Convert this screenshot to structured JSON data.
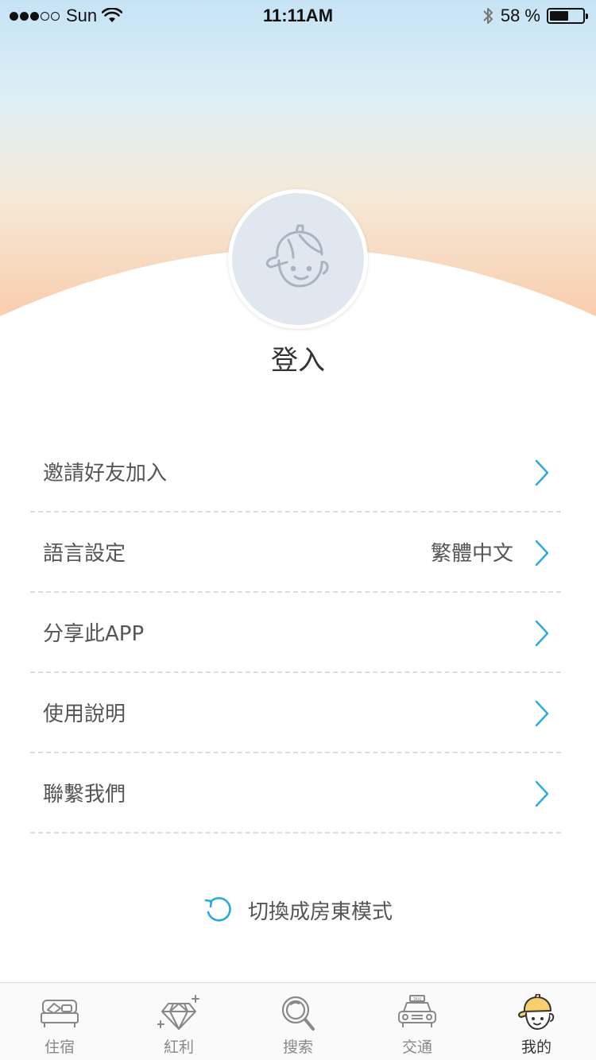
{
  "status_bar": {
    "carrier": "Sun",
    "time": "11:11AM",
    "battery_text": "58 %",
    "battery_level": 0.58
  },
  "profile": {
    "login_label": "登入",
    "avatar_icon": "boy-with-cap-icon"
  },
  "menu": {
    "items": [
      {
        "label": "邀請好友加入",
        "value": ""
      },
      {
        "label": "語言設定",
        "value": "繁體中文"
      },
      {
        "label": "分享此APP",
        "value": ""
      },
      {
        "label": "使用說明",
        "value": ""
      },
      {
        "label": "聯繫我們",
        "value": ""
      }
    ]
  },
  "switch_mode": {
    "label": "切換成房東模式",
    "icon": "refresh-icon"
  },
  "tab_bar": {
    "tabs": [
      {
        "label": "住宿",
        "icon": "bed-icon",
        "active": false
      },
      {
        "label": "紅利",
        "icon": "diamond-icon",
        "active": false
      },
      {
        "label": "搜索",
        "icon": "magnifier-icon",
        "active": false
      },
      {
        "label": "交通",
        "icon": "taxi-icon",
        "active": false
      },
      {
        "label": "我的",
        "icon": "profile-icon",
        "active": true
      }
    ]
  },
  "colors": {
    "accent": "#2aa9e0",
    "avatar_bg": "#e1e7ee",
    "active_tab_icon": "#f7cf6f"
  }
}
